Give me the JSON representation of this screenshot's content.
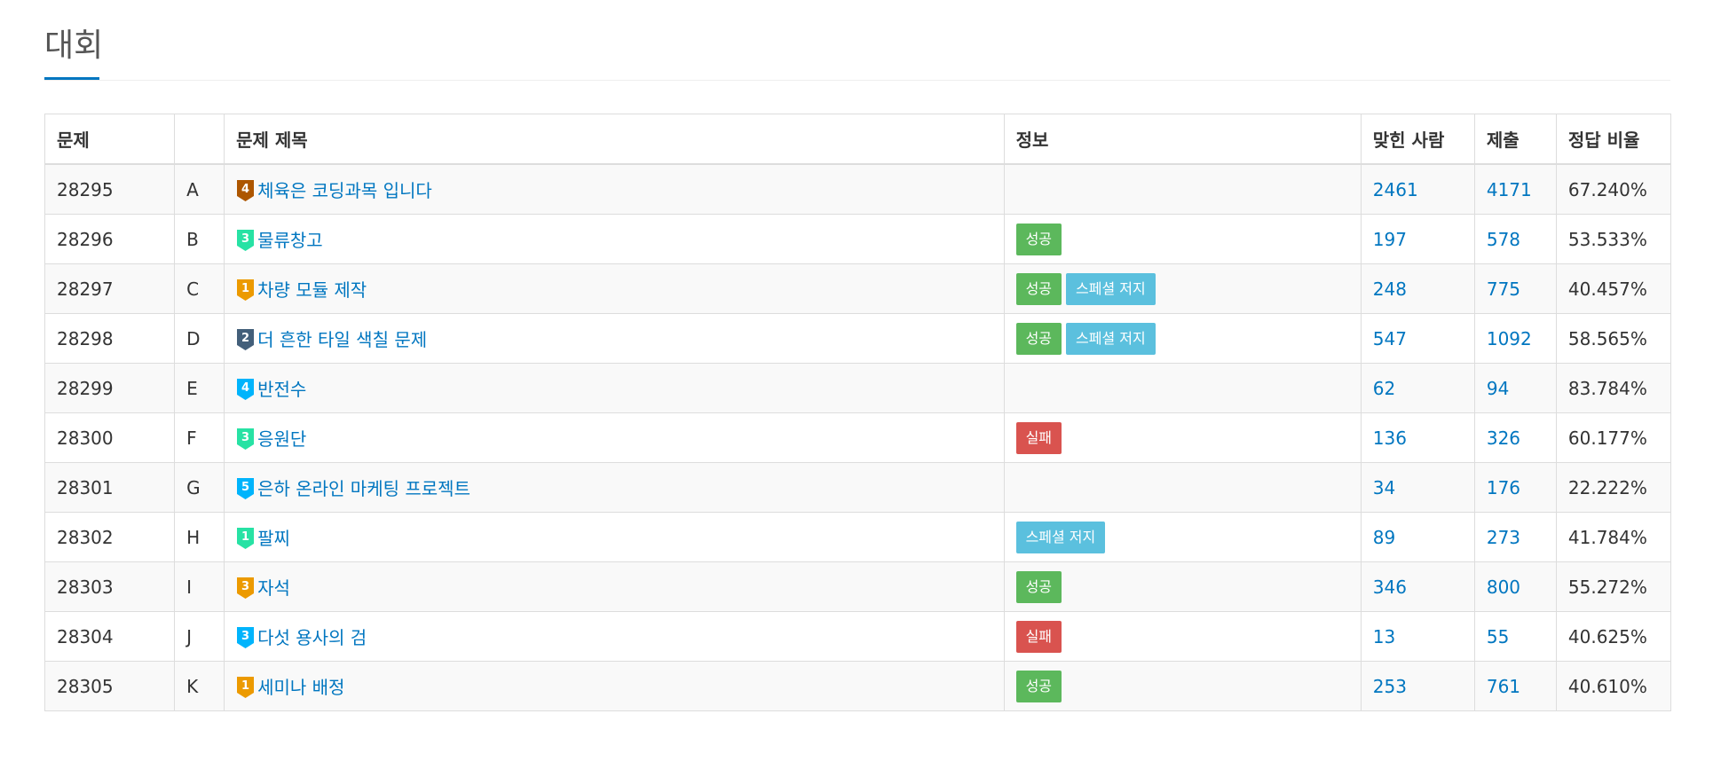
{
  "page": {
    "title": "대회"
  },
  "table": {
    "headers": {
      "problem": "문제",
      "letter": "",
      "problem_title": "문제 제목",
      "info": "정보",
      "solved": "맞힌 사람",
      "submissions": "제출",
      "ratio": "정답 비율"
    },
    "rows": [
      {
        "id": "28295",
        "letter": "A",
        "tier": "4",
        "tier_color": "#ad5600",
        "title": "체육은 코딩과목 입니다",
        "badges": [],
        "solved": "2461",
        "submissions": "4171",
        "ratio": "67.240%"
      },
      {
        "id": "28296",
        "letter": "B",
        "tier": "3",
        "tier_color": "#27e2a4",
        "title": "물류창고",
        "badges": [
          {
            "label": "성공",
            "type": "success"
          }
        ],
        "solved": "197",
        "submissions": "578",
        "ratio": "53.533%"
      },
      {
        "id": "28297",
        "letter": "C",
        "tier": "1",
        "tier_color": "#ec9a00",
        "title": "차량 모듈 제작",
        "badges": [
          {
            "label": "성공",
            "type": "success"
          },
          {
            "label": "스페셜 저지",
            "type": "special"
          }
        ],
        "solved": "248",
        "submissions": "775",
        "ratio": "40.457%"
      },
      {
        "id": "28298",
        "letter": "D",
        "tier": "2",
        "tier_color": "#435f7a",
        "title": "더 흔한 타일 색칠 문제",
        "badges": [
          {
            "label": "성공",
            "type": "success"
          },
          {
            "label": "스페셜 저지",
            "type": "special"
          }
        ],
        "solved": "547",
        "submissions": "1092",
        "ratio": "58.565%"
      },
      {
        "id": "28299",
        "letter": "E",
        "tier": "4",
        "tier_color": "#00b4fc",
        "title": "반전수",
        "badges": [],
        "solved": "62",
        "submissions": "94",
        "ratio": "83.784%"
      },
      {
        "id": "28300",
        "letter": "F",
        "tier": "3",
        "tier_color": "#27e2a4",
        "title": "응원단",
        "badges": [
          {
            "label": "실패",
            "type": "fail"
          }
        ],
        "solved": "136",
        "submissions": "326",
        "ratio": "60.177%"
      },
      {
        "id": "28301",
        "letter": "G",
        "tier": "5",
        "tier_color": "#00b4fc",
        "title": "은하 온라인 마케팅 프로젝트",
        "badges": [],
        "solved": "34",
        "submissions": "176",
        "ratio": "22.222%"
      },
      {
        "id": "28302",
        "letter": "H",
        "tier": "1",
        "tier_color": "#27e2a4",
        "title": "팔찌",
        "badges": [
          {
            "label": "스페셜 저지",
            "type": "special"
          }
        ],
        "solved": "89",
        "submissions": "273",
        "ratio": "41.784%"
      },
      {
        "id": "28303",
        "letter": "I",
        "tier": "3",
        "tier_color": "#ec9a00",
        "title": "자석",
        "badges": [
          {
            "label": "성공",
            "type": "success"
          }
        ],
        "solved": "346",
        "submissions": "800",
        "ratio": "55.272%"
      },
      {
        "id": "28304",
        "letter": "J",
        "tier": "3",
        "tier_color": "#00b4fc",
        "title": "다섯 용사의 검",
        "badges": [
          {
            "label": "실패",
            "type": "fail"
          }
        ],
        "solved": "13",
        "submissions": "55",
        "ratio": "40.625%"
      },
      {
        "id": "28305",
        "letter": "K",
        "tier": "1",
        "tier_color": "#ec9a00",
        "title": "세미나 배정",
        "badges": [
          {
            "label": "성공",
            "type": "success"
          }
        ],
        "solved": "253",
        "submissions": "761",
        "ratio": "40.610%"
      }
    ]
  },
  "colors": {
    "link": "#0076c0",
    "success": "#5cb85c",
    "special_judge": "#5bc0de",
    "fail": "#d9534f",
    "accent_underline": "#0076c0"
  },
  "icons": {
    "tier": "tier-shield-icon"
  }
}
